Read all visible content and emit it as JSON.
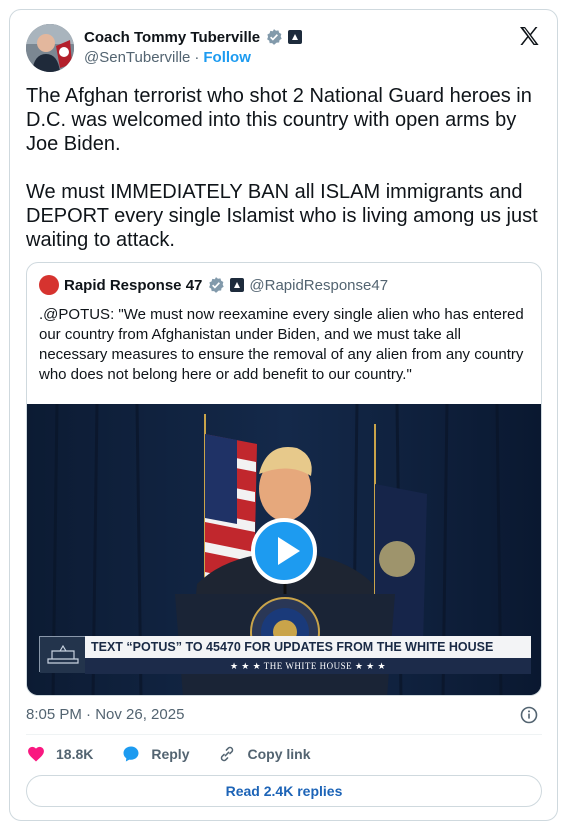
{
  "author": {
    "display_name": "Coach Tommy Tuberville",
    "handle": "@SenTuberville",
    "separator": "·",
    "follow_label": "Follow"
  },
  "tweet": {
    "paragraphs": [
      "The Afghan terrorist who shot 2 National Guard heroes in D.C. was welcomed into this country with open arms by Joe Biden.",
      "We must IMMEDIATELY BAN all ISLAM immigrants and DEPORT every single Islamist who is living among us just waiting to attack."
    ],
    "timestamp": "8:05 PM · Nov 26, 2025"
  },
  "quote": {
    "display_name": "Rapid Response 47",
    "handle": "@RapidResponse47",
    "text": ".@POTUS: \"We must now reexamine every single alien who has entered our country from Afghanistan under Biden, and we must take all necessary measures to ensure the removal of any alien from any country who does not belong here or add benefit to our country.\"",
    "video": {
      "lower_third_main": "TEXT “POTUS” TO 45470 FOR UPDATES FROM THE WHITE HOUSE",
      "lower_third_sub": "★ ★ ★   THE WHITE HOUSE   ★ ★ ★"
    }
  },
  "actions": {
    "like_count": "18.8K",
    "reply_label": "Reply",
    "copy_link_label": "Copy link"
  },
  "read_replies_label": "Read 2.4K replies",
  "colors": {
    "accent": "#1d9bf0",
    "like": "#f91880",
    "verified": "#829aab",
    "muted_text": "#536471"
  },
  "icons": {
    "verified": "verified-badge-icon",
    "gov": "government-badge-icon",
    "x": "x-logo-icon",
    "info": "info-icon",
    "like": "heart-icon",
    "reply": "reply-bubble-icon",
    "copy": "link-icon",
    "play": "play-icon"
  }
}
